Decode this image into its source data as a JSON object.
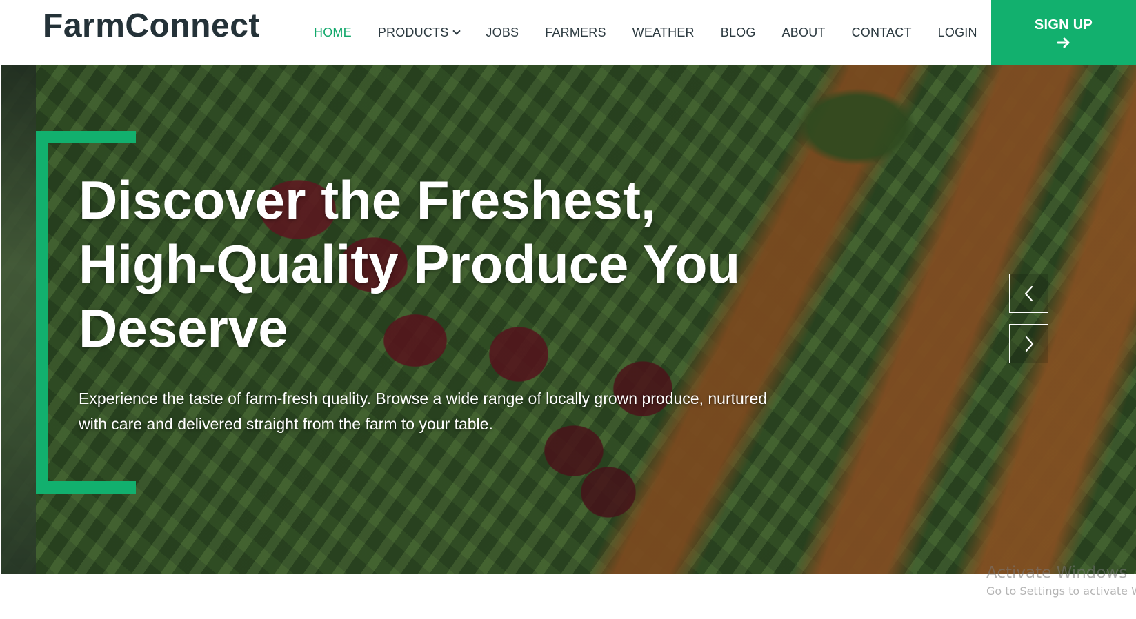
{
  "brand": {
    "name": "FarmConnect"
  },
  "nav": {
    "items": [
      {
        "label": "HOME",
        "active": true
      },
      {
        "label": "PRODUCTS",
        "dropdown": true
      },
      {
        "label": "JOBS"
      },
      {
        "label": "FARMERS"
      },
      {
        "label": "WEATHER"
      },
      {
        "label": "BLOG"
      },
      {
        "label": "ABOUT"
      },
      {
        "label": "CONTACT"
      },
      {
        "label": "LOGIN"
      }
    ],
    "signup_label": "SIGN UP",
    "signup_icon": "arrow-right-icon"
  },
  "hero": {
    "title_lines": [
      "Discover the Freshest,",
      "High-Quality Produce You",
      "Deserve"
    ],
    "subtitle": "Experience the taste of farm-fresh quality. Browse a wide range of locally grown produce, nurtured with care and delivered straight from the farm to your table.",
    "prev_icon": "chevron-left-icon",
    "next_icon": "chevron-right-icon"
  },
  "watermark": {
    "title": "Activate Windows",
    "subtitle": "Go to Settings to activate Windows."
  },
  "colors": {
    "accent": "#12b06e",
    "active_nav": "#12a86b",
    "brand_text": "#243238"
  }
}
